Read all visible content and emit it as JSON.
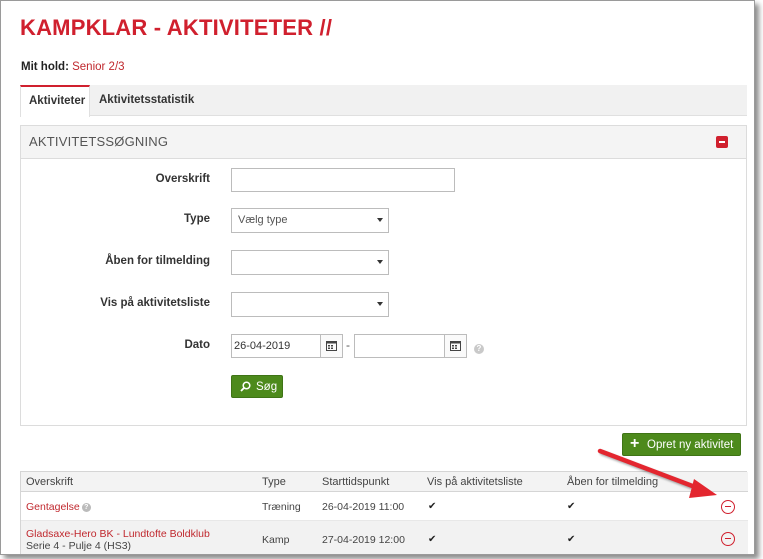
{
  "page": {
    "title": "KAMPKLAR - AKTIVITETER //",
    "team_label": "Mit hold:",
    "team_value": "Senior 2/3"
  },
  "tabs": [
    {
      "label": "Aktiviteter",
      "active": true
    },
    {
      "label": "Aktivitetsstatistik",
      "active": false
    }
  ],
  "search_panel": {
    "title": "AKTIVITETSSØGNING",
    "fields": {
      "overskrift": {
        "label": "Overskrift",
        "value": ""
      },
      "type": {
        "label": "Type",
        "value": "Vælg type"
      },
      "aaben": {
        "label": "Åben for tilmelding",
        "value": ""
      },
      "vis": {
        "label": "Vis på aktivitetsliste",
        "value": ""
      },
      "dato": {
        "label": "Dato",
        "from": "26-04-2019",
        "to": "",
        "separator": "-",
        "help": "?"
      }
    },
    "search_button": "Søg"
  },
  "create_button": "Opret ny aktivitet",
  "table": {
    "headers": [
      "Overskrift",
      "Type",
      "Starttidspunkt",
      "Vis på aktivitetsliste",
      "Åben for tilmelding"
    ],
    "rows": [
      {
        "title": "Gentagelse",
        "subtitle": "",
        "type": "Træning",
        "start": "26-04-2019 11:00",
        "vis": "✔",
        "aaben": "✔"
      },
      {
        "title": "Gladsaxe-Hero BK - Lundtofte Boldklub",
        "subtitle": "Serie 4 - Pulje 4 (HS3)",
        "type": "Kamp",
        "start": "27-04-2019 12:00",
        "vis": "✔",
        "aaben": "✔"
      }
    ]
  },
  "colors": {
    "brand_red": "#d0202e",
    "button_green": "#4d8a1c"
  }
}
